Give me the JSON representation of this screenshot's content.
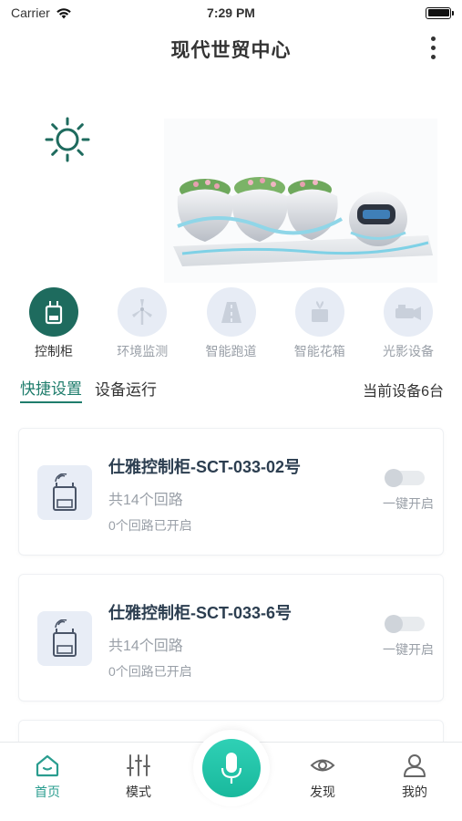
{
  "status_bar": {
    "carrier": "Carrier",
    "time": "7:29 PM"
  },
  "nav": {
    "title": "现代世贸中心"
  },
  "categories": [
    {
      "label": "控制柜",
      "icon": "cabinet-icon",
      "active": true
    },
    {
      "label": "环境监测",
      "icon": "wind-turbine-icon",
      "active": false
    },
    {
      "label": "智能跑道",
      "icon": "runway-icon",
      "active": false
    },
    {
      "label": "智能花箱",
      "icon": "planter-icon",
      "active": false
    },
    {
      "label": "光影设备",
      "icon": "projector-icon",
      "active": false
    }
  ],
  "tabs": [
    {
      "label": "快捷设置",
      "active": true
    },
    {
      "label": "设备运行",
      "active": false
    }
  ],
  "device_count": "当前设备6台",
  "devices": [
    {
      "name": "仕雅控制柜-SCT-033-02号",
      "circuits": "共14个回路",
      "open": "0个回路已开启",
      "action": "一键开启",
      "on": false
    },
    {
      "name": "仕雅控制柜-SCT-033-6号",
      "circuits": "共14个回路",
      "open": "0个回路已开启",
      "action": "一键开启",
      "on": false
    }
  ],
  "tab_bar": [
    {
      "label": "首页",
      "icon": "home-icon",
      "active": true
    },
    {
      "label": "模式",
      "icon": "sliders-icon",
      "active": false
    },
    {
      "label": "",
      "icon": "microphone-icon",
      "active": false
    },
    {
      "label": "发现",
      "icon": "eye-icon",
      "active": false
    },
    {
      "label": "我的",
      "icon": "user-icon",
      "active": false
    }
  ],
  "colors": {
    "accent": "#1e6b5e",
    "tab_active": "#1f7d6c",
    "mic": "#1fc1a5",
    "muted": "#9aa0a8"
  }
}
